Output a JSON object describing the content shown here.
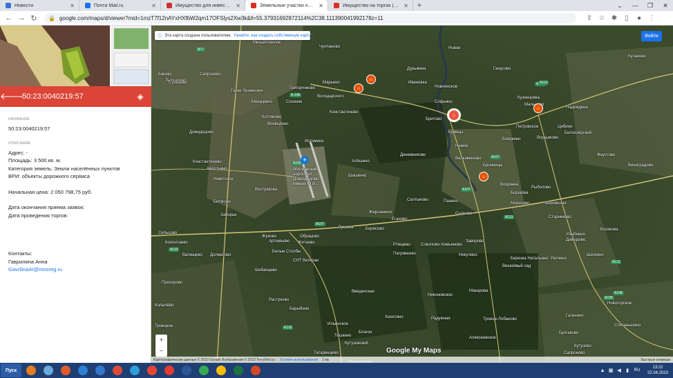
{
  "browser": {
    "tabs": [
      {
        "label": "Новости",
        "color": "#3b6fd9"
      },
      {
        "label": "Почта Mail.ru",
        "color": "#1a73e8"
      },
      {
        "label": "Имущество для инвесторов",
        "color": "#cc3333"
      },
      {
        "label": "Земельные участки на торги (Go…",
        "color": "#d93025",
        "active": true
      },
      {
        "label": "Имущество на торгах (Google Ma…",
        "color": "#d93025"
      }
    ],
    "new_tab": "+",
    "url": "google.com/maps/d/viewer?mid=1mzT7f12nAYxHXfbW2qm17OFSlys2Xw3k&ll=55.37931692872114%2C38.111390041992178z=11"
  },
  "panel": {
    "title": "50:23:0040219:57",
    "name_label": "НАЗВАНИЕ",
    "name_value": "50:23:0040219:57",
    "desc_label": "ОПИСАНИЕ",
    "address": "Адрес: -",
    "area": "Площадь: 3 500 кв. м.",
    "category": "Категория земель: Земли населённых пунктов",
    "vri": "ВРИ: объекты дорожного сервиса",
    "price": "Начальная цена: 2 050 798,75 руб.",
    "deadline": "Дата окончания приема заявок:",
    "auction_date": "Дата проведения торгов:",
    "contacts": "Контакты:",
    "contact_name": "Гаврилина Анна",
    "contact_email": "GavrilinaAI@mosreg.ru"
  },
  "map": {
    "notice_text": "Эта карта создана пользователем.",
    "notice_link": "Узнайте, как создать собственную карту",
    "signin": "Войти",
    "zoom_in": "+",
    "zoom_out": "−",
    "logo": "Google My Maps",
    "attribution": "Картографические данные © 2023 Google Изображения © 2023 TerraMetrics",
    "terms": "Условия использования",
    "scale": "2 км",
    "fast": "Быстрые клавиши",
    "airport": "Московский аэропорт Домодедово имени М.В...",
    "places": [
      [
        "Михайловское",
        147,
        2
      ],
      [
        "Чулпаново",
        243,
        8
      ],
      [
        "Новое",
        430,
        10
      ],
      [
        "Кулаково",
        690,
        22
      ],
      [
        "Бяково",
        10,
        48
      ],
      [
        "Сапроново",
        70,
        48
      ],
      [
        "Марьино",
        248,
        60
      ],
      [
        "Новленское",
        410,
        66
      ],
      [
        "Дурыкина",
        370,
        40
      ],
      [
        "Лыткарино",
        20,
        57
      ],
      [
        "Суханово",
        25,
        60
      ],
      [
        "Горки Ленинские",
        115,
        72
      ],
      [
        "Григорчиково",
        200,
        68
      ],
      [
        "Володарского",
        240,
        80
      ],
      [
        "Ивановка",
        372,
        60
      ],
      [
        "Мещерино",
        145,
        88
      ],
      [
        "Сосенки",
        195,
        88
      ],
      [
        "Константиново",
        258,
        103
      ],
      [
        "Софьино",
        410,
        88
      ],
      [
        "Ганусово",
        495,
        40
      ],
      [
        "Кузнецовка",
        530,
        82
      ],
      [
        "Мальцево",
        540,
        92
      ],
      [
        "Надеждино",
        600,
        96
      ],
      [
        "Котляково",
        160,
        110
      ],
      [
        "Воеводино",
        168,
        120
      ],
      [
        "Бритово",
        397,
        113
      ],
      [
        "Петровское",
        528,
        124
      ],
      [
        "Цибино",
        588,
        124
      ],
      [
        "Домодедово",
        55,
        132
      ],
      [
        "Истомиха",
        222,
        145
      ],
      [
        "Кривцы",
        430,
        132
      ],
      [
        "Бояркино",
        508,
        142
      ],
      [
        "Ворщиково",
        558,
        140
      ],
      [
        "Белоозёрский",
        598,
        133
      ],
      [
        "Денежниково",
        360,
        165
      ],
      [
        "Немое",
        440,
        152
      ],
      [
        "Вельяминово",
        440,
        170
      ],
      [
        "Бронницы",
        480,
        180
      ],
      [
        "Фаустово",
        645,
        165
      ],
      [
        "Константиново",
        60,
        175
      ],
      [
        "Авдотьино",
        80,
        185
      ],
      [
        "Алёшино",
        290,
        174
      ],
      [
        "Виноградово",
        690,
        180
      ],
      [
        "Никитское",
        90,
        200
      ],
      [
        "Шишкино",
        285,
        195
      ],
      [
        "Вохринка",
        505,
        208
      ],
      [
        "Борщёва",
        520,
        220
      ],
      [
        "Рыболово",
        550,
        212
      ],
      [
        "Битягово",
        90,
        233
      ],
      [
        "Вострякова",
        150,
        215
      ],
      [
        "Салтыково",
        370,
        230
      ],
      [
        "Панино",
        423,
        232
      ],
      [
        "Морозово",
        520,
        235
      ],
      [
        "Заборье",
        100,
        252
      ],
      [
        "Жирошкино",
        315,
        248
      ],
      [
        "Еганово",
        348,
        258
      ],
      [
        "Шаховская",
        570,
        235
      ],
      [
        "Старниково",
        575,
        255
      ],
      [
        "Сырково",
        440,
        250
      ],
      [
        "Лукьянь",
        270,
        270
      ],
      [
        "Борисово",
        310,
        272
      ],
      [
        "Улыбнено",
        600,
        280
      ],
      [
        "Косякова",
        650,
        273
      ],
      [
        "Сельцово",
        10,
        278
      ],
      [
        "Жуково",
        160,
        283
      ],
      [
        "Обрацово",
        215,
        283
      ],
      [
        "Заворово",
        455,
        290
      ],
      [
        "Давыдово",
        600,
        288
      ],
      [
        "Колонтаево",
        20,
        292
      ],
      [
        "Артемьево",
        170,
        290
      ],
      [
        "Житнево",
        212,
        292
      ],
      [
        "Ртищево",
        350,
        295
      ],
      [
        "Соколово-Хомьяново",
        390,
        295
      ],
      [
        "Валищево",
        45,
        310
      ],
      [
        "Долматово",
        85,
        310
      ],
      [
        "Белые Столбы",
        175,
        305
      ],
      [
        "Патрикеево",
        350,
        308
      ],
      [
        "Никулино",
        445,
        310
      ],
      [
        "Березка Натальино",
        520,
        315
      ],
      [
        "Ратчино",
        578,
        315
      ],
      [
        "Шелкино",
        630,
        310
      ],
      [
        "СНТ Ветеран",
        205,
        318
      ],
      [
        "Вишнёвый сад",
        508,
        326
      ],
      [
        "Шебанцево",
        150,
        332
      ],
      [
        "Прохорово",
        15,
        350
      ],
      [
        "Введенская",
        290,
        363
      ],
      [
        "Никоновское",
        400,
        368
      ],
      [
        "Макарова",
        460,
        362
      ],
      [
        "Растуново",
        170,
        375
      ],
      [
        "Колычёво",
        5,
        383
      ],
      [
        "Барыбино",
        200,
        388
      ],
      [
        "Новогорское",
        660,
        380
      ],
      [
        "Хонятино",
        338,
        400
      ],
      [
        "Радужная",
        405,
        402
      ],
      [
        "Троице-Лобаново",
        480,
        403
      ],
      [
        "Ильинское",
        255,
        410
      ],
      [
        "Троицкое",
        5,
        413
      ],
      [
        "Гальчино",
        600,
        398
      ],
      [
        "Степаньшино",
        670,
        412
      ],
      [
        "Алексеевское",
        460,
        430
      ],
      [
        "Булгаково",
        590,
        423
      ],
      [
        "Благое",
        300,
        422
      ],
      [
        "Тишкино",
        265,
        427
      ],
      [
        "Кутузовский",
        280,
        438
      ],
      [
        "Кутузово",
        612,
        442
      ],
      [
        "Сапроново",
        597,
        452
      ],
      [
        "Татаринцево",
        235,
        452
      ],
      [
        "Марьинское",
        285,
        465
      ],
      [
        "Борисово",
        640,
        478
      ],
      [
        "Сорокино",
        145,
        480
      ],
      [
        "Лагринки",
        155,
        462
      ]
    ],
    "shields": [
      [
        "М-2",
        65,
        12
      ],
      [
        "А-106",
        200,
        78
      ],
      [
        "А107",
        555,
        62
      ],
      [
        "А113",
        560,
        60
      ],
      [
        "А105",
        203,
        177
      ],
      [
        "А107",
        490,
        168
      ],
      [
        "А107",
        448,
        215
      ],
      [
        "А113",
        510,
        255
      ],
      [
        "А107",
        236,
        265
      ],
      [
        "А113",
        25,
        302
      ],
      [
        "А113",
        665,
        320
      ],
      [
        "А108",
        668,
        365
      ],
      [
        "А108",
        654,
        372
      ],
      [
        "Е115",
        190,
        415
      ]
    ],
    "pins": [
      [
        293,
        84,
        false
      ],
      [
        311,
        71,
        false
      ],
      [
        428,
        120,
        true
      ],
      [
        553,
        113,
        false
      ],
      [
        474,
        212,
        false
      ]
    ]
  },
  "taskbar": {
    "start": "Пуск",
    "icon_colors": [
      "#e57e23",
      "#6aa9d8",
      "#e05d2a",
      "#2d7fd3",
      "#3277c9",
      "#dd4b39",
      "#2a9fd8",
      "#ea4335",
      "#e53935",
      "#2b5797",
      "#34a853",
      "#fbbc05",
      "#1e7145",
      "#d24726"
    ],
    "lang": "RU",
    "time": "13:22",
    "date": "22.04.2023"
  },
  "colors": {
    "panel_header": "#db4437",
    "accent": "#1a73e8",
    "pin": "#e65100"
  }
}
